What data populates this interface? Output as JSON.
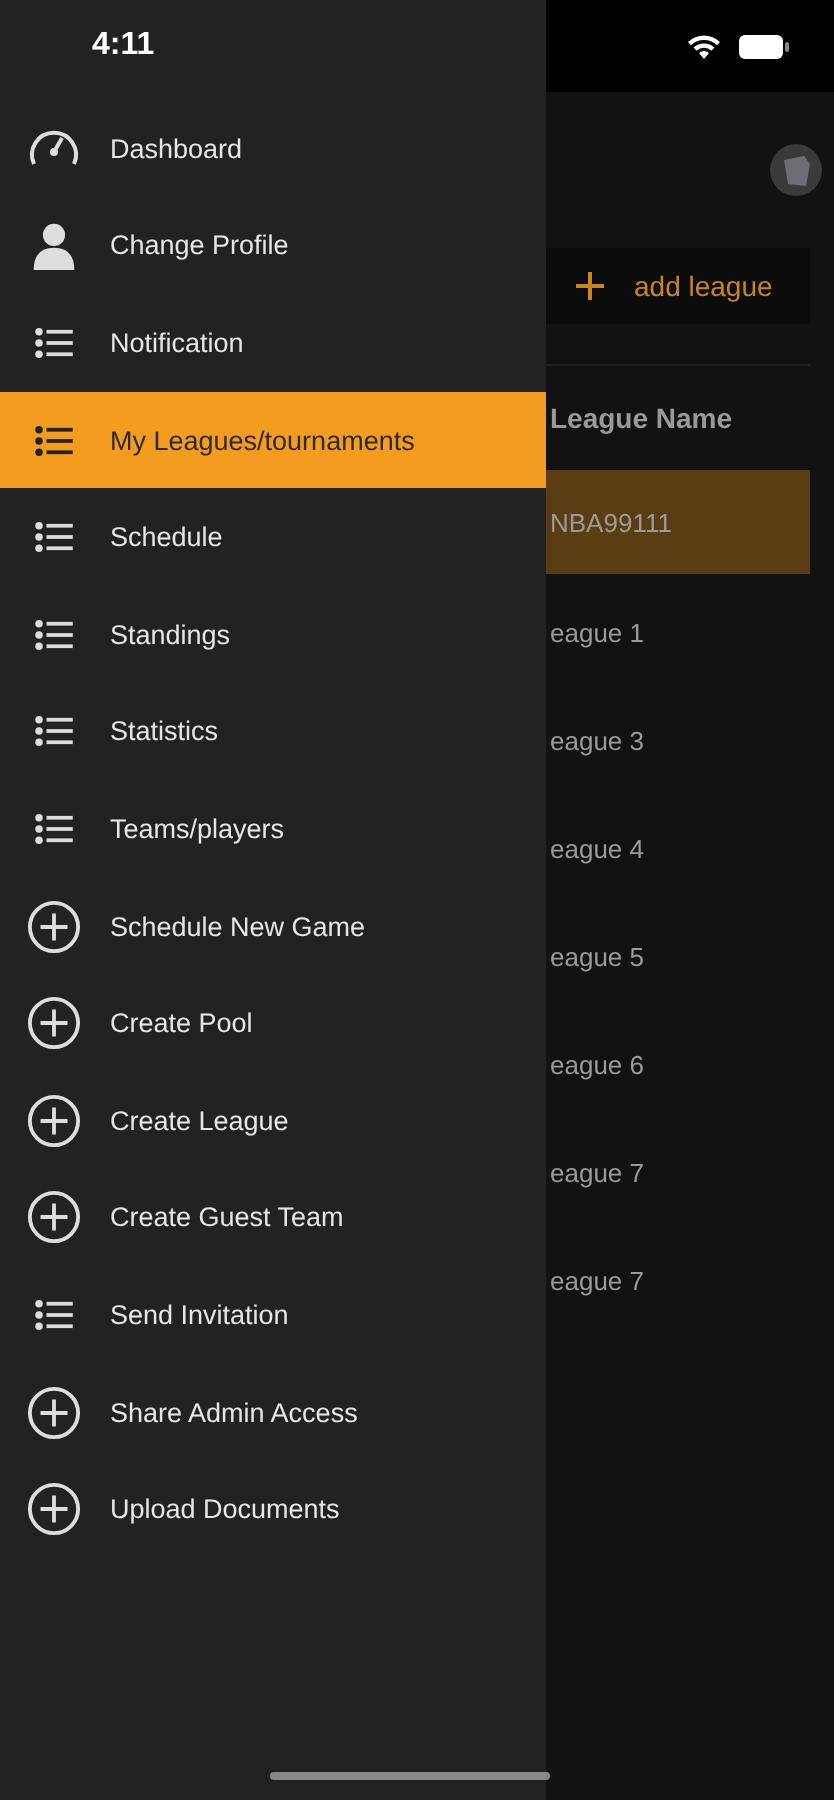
{
  "status_bar": {
    "time": "4:11"
  },
  "drawer": {
    "items": [
      {
        "label": "Dashboard",
        "kind": "gauge",
        "selected": false
      },
      {
        "label": "Change Profile",
        "kind": "person",
        "selected": false
      },
      {
        "label": "Notification",
        "kind": "list",
        "selected": false
      },
      {
        "label": "My Leagues/tournaments",
        "kind": "list",
        "selected": true
      },
      {
        "label": "Schedule",
        "kind": "list",
        "selected": false
      },
      {
        "label": "Standings",
        "kind": "list",
        "selected": false
      },
      {
        "label": "Statistics",
        "kind": "list",
        "selected": false
      },
      {
        "label": "Teams/players",
        "kind": "list",
        "selected": false
      },
      {
        "label": "Schedule New Game",
        "kind": "plus",
        "selected": false
      },
      {
        "label": "Create Pool",
        "kind": "plus",
        "selected": false
      },
      {
        "label": "Create League",
        "kind": "plus",
        "selected": false
      },
      {
        "label": "Create Guest Team",
        "kind": "plus",
        "selected": false
      },
      {
        "label": "Send Invitation",
        "kind": "list",
        "selected": false
      },
      {
        "label": "Share Admin Access",
        "kind": "plus",
        "selected": false
      },
      {
        "label": "Upload Documents",
        "kind": "plus",
        "selected": false
      }
    ]
  },
  "page": {
    "add_button": "add league",
    "table": {
      "column": "League Name",
      "rows": [
        {
          "name": "NBA99111",
          "selected": true
        },
        {
          "name": "eague 1",
          "selected": false
        },
        {
          "name": "eague 3",
          "selected": false
        },
        {
          "name": "eague 4",
          "selected": false
        },
        {
          "name": "eague 5",
          "selected": false
        },
        {
          "name": "eague 6",
          "selected": false
        },
        {
          "name": "eague 7",
          "selected": false
        },
        {
          "name": "eague 7",
          "selected": false
        }
      ]
    }
  }
}
